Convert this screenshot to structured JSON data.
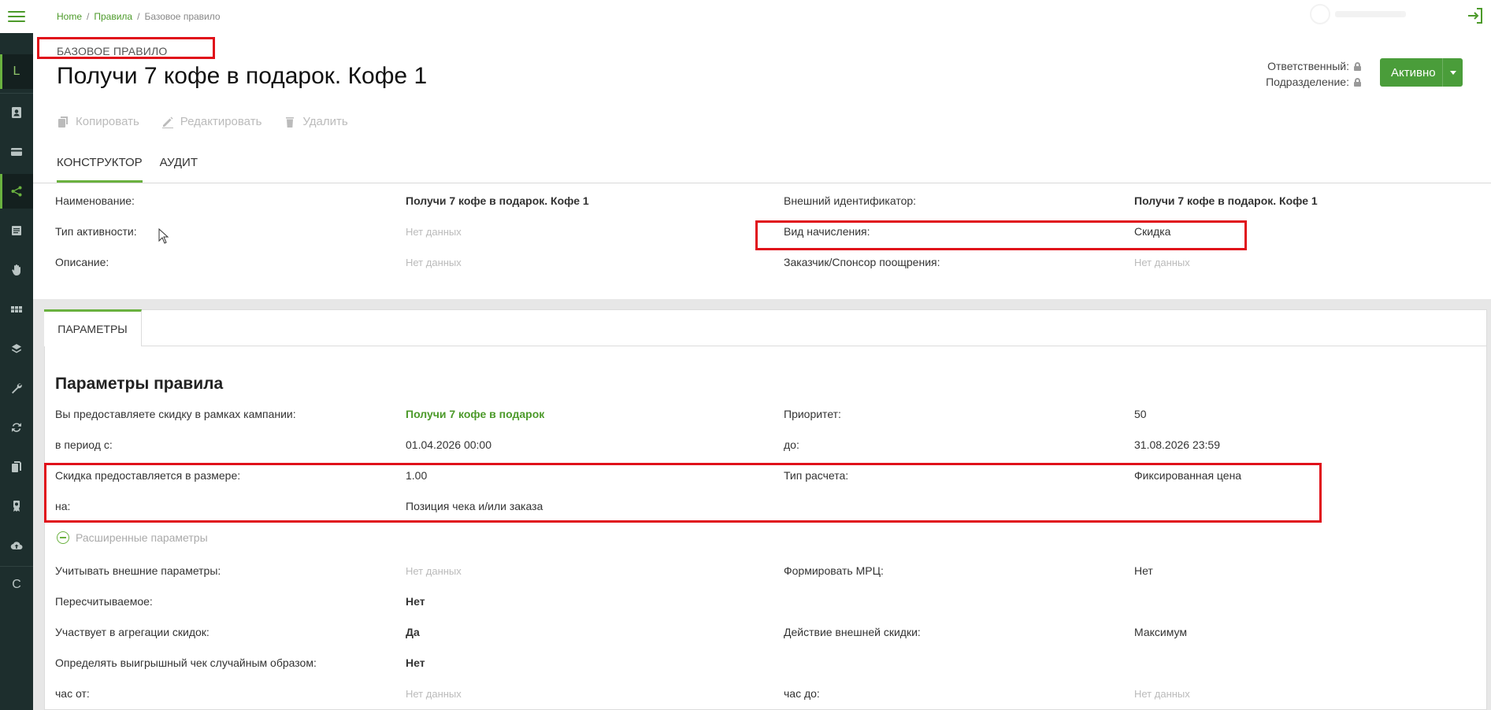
{
  "breadcrumb": {
    "home": "Home",
    "rules": "Правила",
    "current": "Базовое правило"
  },
  "sidebar": {
    "top_letter": "L",
    "bottom_letter": "C",
    "icons": [
      "contact-icon",
      "card-icon",
      "share-icon",
      "list-icon",
      "hand-icon",
      "grid-icon",
      "layers-icon",
      "wrench-icon",
      "sync-icon",
      "copy-docs-icon",
      "certificate-icon",
      "cloud-upload-icon"
    ]
  },
  "header": {
    "kind": "БАЗОВОЕ ПРАВИЛО",
    "title": "Получи 7 кофе в подарок. Кофе 1",
    "responsible_label": "Ответственный:",
    "division_label": "Подразделение:",
    "status": "Активно"
  },
  "actions": {
    "copy": "Копировать",
    "edit": "Редактировать",
    "delete": "Удалить"
  },
  "tabs": {
    "constructor": "КОНСТРУКТОР",
    "audit": "АУДИТ"
  },
  "general": {
    "name_label": "Наименование:",
    "name_value": "Получи 7 кофе в подарок. Кофе 1",
    "ext_id_label": "Внешний идентификатор:",
    "ext_id_value": "Получи 7 кофе в подарок. Кофе 1",
    "activity_label": "Тип активности:",
    "activity_value": "Нет данных",
    "accrual_label": "Вид начисления:",
    "accrual_value": "Скидка",
    "description_label": "Описание:",
    "description_value": "Нет данных",
    "sponsor_label": "Заказчик/Спонсор поощрения:",
    "sponsor_value": "Нет данных"
  },
  "params": {
    "tab": "ПАРАМЕТРЫ",
    "title": "Параметры правила",
    "campaign_label": "Вы предоставляете скидку в рамках кампании:",
    "campaign_value": "Получи 7 кофе в подарок",
    "priority_label": "Приоритет:",
    "priority_value": "50",
    "from_label": "в период с:",
    "from_value": "01.04.2026 00:00",
    "to_label": "до:",
    "to_value": "31.08.2026 23:59",
    "size_label": "Скидка предоставляется в размере:",
    "size_value": "1.00",
    "calc_label": "Тип расчета:",
    "calc_value": "Фиксированная цена",
    "on_label": "на:",
    "on_value": "Позиция чека и/или заказа",
    "extended": "Расширенные параметры",
    "external_label": "Учитывать внешние параметры:",
    "external_value": "Нет данных",
    "mrc_label": "Формировать МРЦ:",
    "mrc_value": "Нет",
    "recalc_label": "Пересчитываемое:",
    "recalc_value": "Нет",
    "aggregation_label": "Участвует в агрегации скидок:",
    "aggregation_value": "Да",
    "ext_discount_label": "Действие внешней скидки:",
    "ext_discount_value": "Максимум",
    "random_label": "Определять выигрышный чек случайным образом:",
    "random_value": "Нет",
    "hour_from_label": "час от:",
    "hour_from_value": "Нет данных",
    "hour_to_label": "час до:",
    "hour_to_value": "Нет данных"
  },
  "colors": {
    "accent": "#4a9d3a",
    "sidebar": "#1d2e2d",
    "highlight": "#e0101a"
  }
}
